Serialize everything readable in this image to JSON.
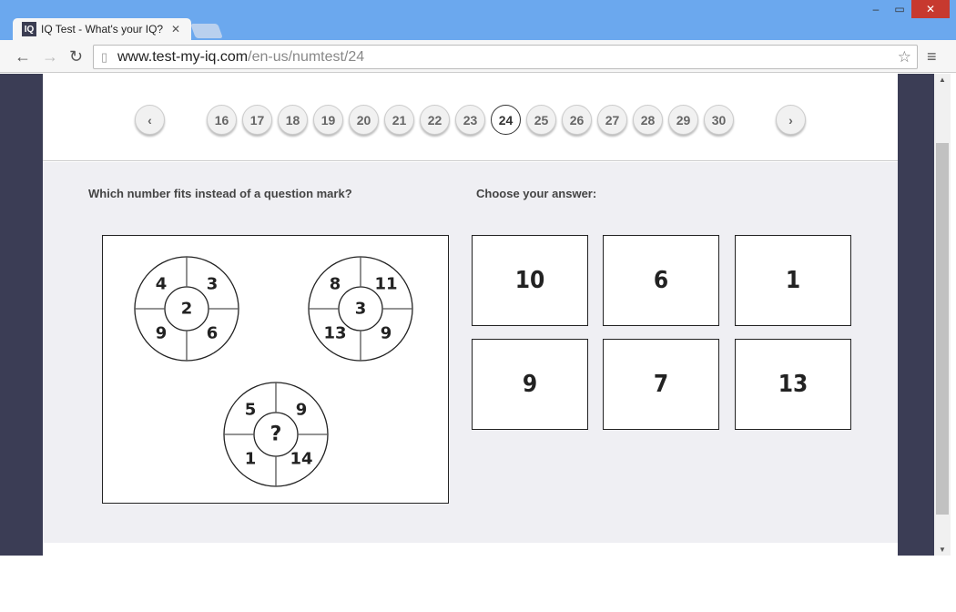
{
  "browser": {
    "tab_title": "IQ Test - What's your IQ?",
    "tab_logo": "IQ",
    "url_host": "www.test-my-iq.com",
    "url_path": "/en-us/numtest/24"
  },
  "pager": {
    "pages": [
      "16",
      "17",
      "18",
      "19",
      "20",
      "21",
      "22",
      "23",
      "24",
      "25",
      "26",
      "27",
      "28",
      "29",
      "30"
    ],
    "current": "24"
  },
  "question": {
    "prompt": "Which number fits instead of a question mark?",
    "choose_label": "Choose your answer:"
  },
  "puzzle": {
    "circles": [
      {
        "center": "2",
        "tl": "4",
        "tr": "3",
        "bl": "9",
        "br": "6"
      },
      {
        "center": "3",
        "tl": "8",
        "tr": "11",
        "bl": "13",
        "br": "9"
      },
      {
        "center": "?",
        "tl": "5",
        "tr": "9",
        "bl": "1",
        "br": "14"
      }
    ],
    "question_color": "#f08a30"
  },
  "answers": [
    "10",
    "6",
    "1",
    "9",
    "7",
    "13"
  ]
}
